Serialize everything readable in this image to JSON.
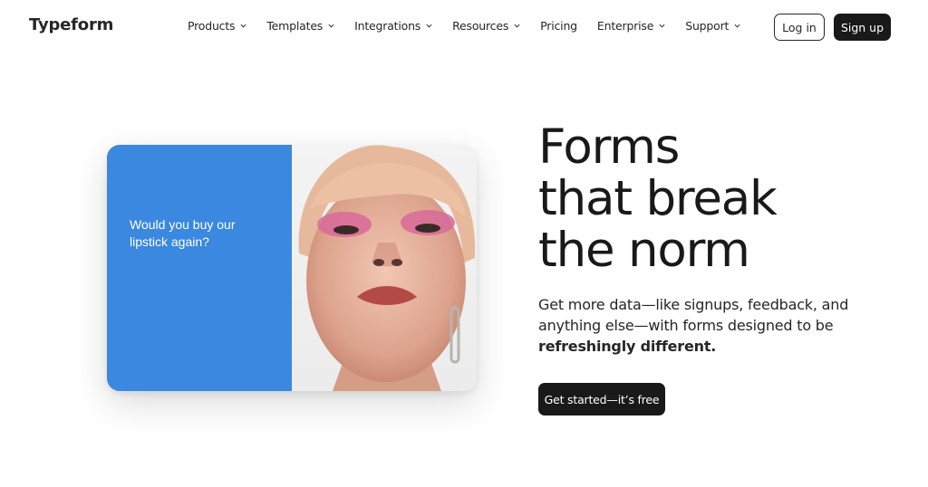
{
  "header": {
    "logo": "Typeform",
    "nav": [
      {
        "label": "Products",
        "has_dropdown": true
      },
      {
        "label": "Templates",
        "has_dropdown": true
      },
      {
        "label": "Integrations",
        "has_dropdown": true
      },
      {
        "label": "Resources",
        "has_dropdown": true
      },
      {
        "label": "Pricing",
        "has_dropdown": false
      },
      {
        "label": "Enterprise",
        "has_dropdown": true
      },
      {
        "label": "Support",
        "has_dropdown": true
      }
    ],
    "login_label": "Log in",
    "signup_label": "Sign up"
  },
  "hero": {
    "card_question": "Would you buy our lipstick again?",
    "card_photo_icon": "portrait-photo",
    "headline": [
      "Forms",
      "that break",
      "the norm"
    ],
    "subheadline_prefix": "Get more data—like signups, feedback, and anything else—with forms designed to be ",
    "subheadline_bold": "refreshingly different.",
    "cta_label": "Get started—it’s free"
  },
  "colors": {
    "card_blue": "#3a88e0",
    "primary_dark": "#191919",
    "background": "#ffffff"
  }
}
